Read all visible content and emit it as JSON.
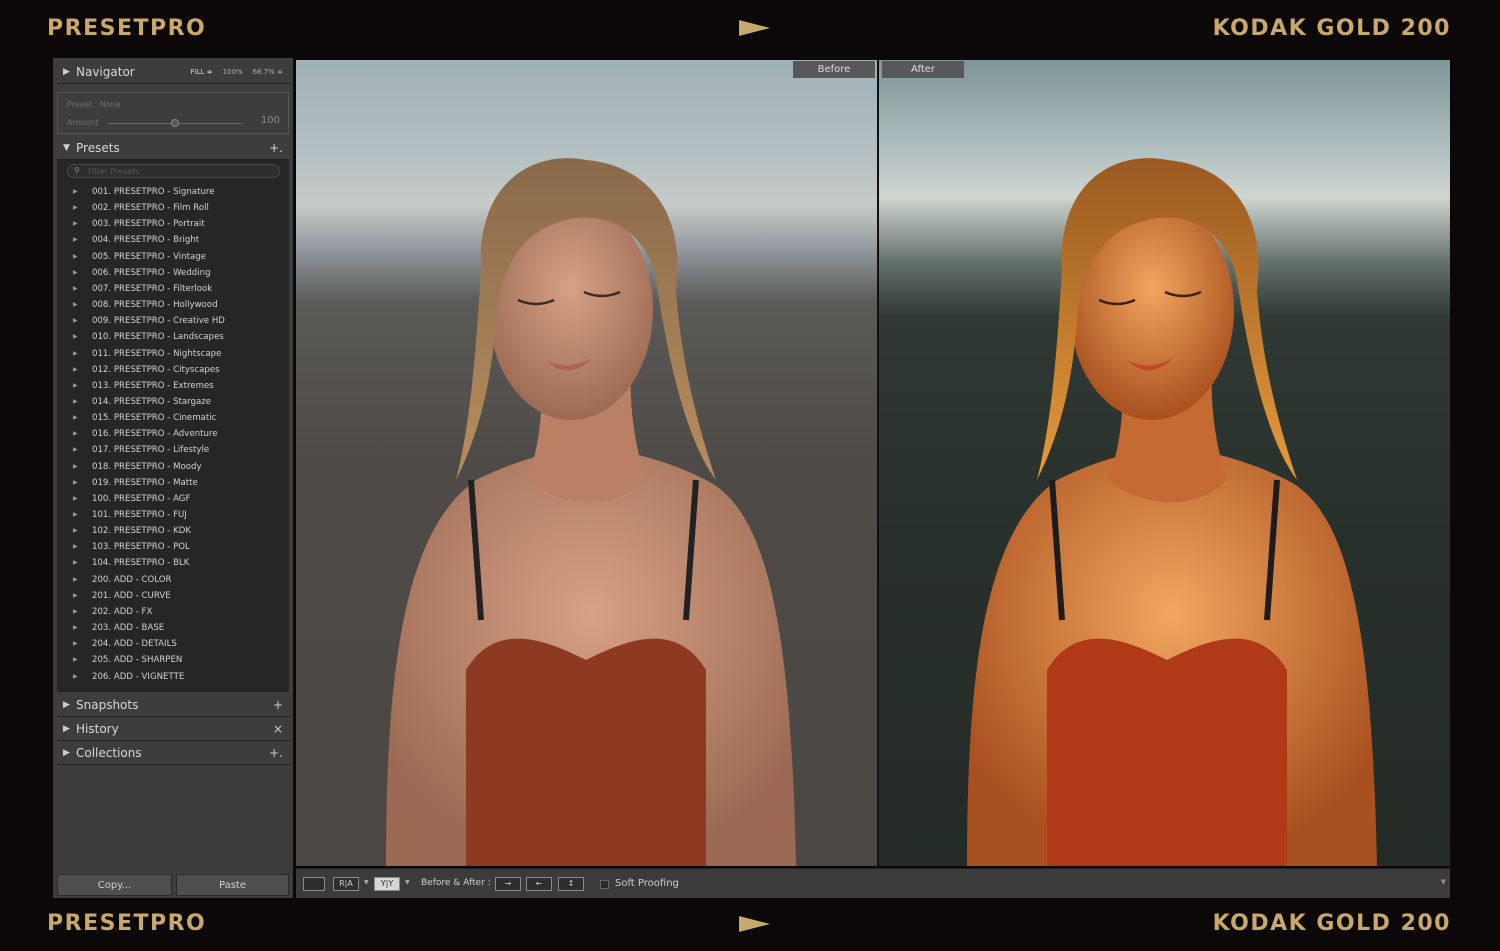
{
  "brand": {
    "left": "PRESETPRO",
    "right": "KODAK GOLD 200",
    "accent_color": "#c9a96a"
  },
  "navigator": {
    "title": "Navigator",
    "fill": "FILL ≑",
    "zoom_100": "100%",
    "zoom_667": "66.7% ≑"
  },
  "preset_info": {
    "preset_label": "Preset : None",
    "amount_label": "Amount",
    "amount_value": "100",
    "amount_fraction": 0.5
  },
  "presets_panel": {
    "title": "Presets",
    "add": "+.",
    "filter_placeholder": "Filter Presets",
    "items": [
      "001. PRESETPRO - Signature",
      "002. PRESETPRO - Film Roll",
      "003. PRESETPRO - Portrait",
      "004. PRESETPRO - Bright",
      "005. PRESETPRO - Vintage",
      "006. PRESETPRO - Wedding",
      "007. PRESETPRO - Filterlook",
      "008. PRESETPRO - Hollywood",
      "009. PRESETPRO - Creative HD",
      "010. PRESETPRO - Landscapes",
      "011. PRESETPRO - Nightscape",
      "012. PRESETPRO - Cityscapes",
      "013. PRESETPRO - Extremes",
      "014. PRESETPRO - Stargaze",
      "015. PRESETPRO - Cinematic",
      "016. PRESETPRO - Adventure",
      "017. PRESETPRO - Lifestyle",
      "018. PRESETPRO - Moody",
      "019. PRESETPRO - Matte",
      "100. PRESETPRO - AGF",
      "101. PRESETPRO - FUJ",
      "102. PRESETPRO - KDK",
      "103. PRESETPRO - POL",
      "104. PRESETPRO - BLK",
      "200. ADD - COLOR",
      "201. ADD - CURVE",
      "202. ADD - FX",
      "203. ADD - BASE",
      "204. ADD - DETAILS",
      "205. ADD - SHARPEN",
      "206. ADD - VIGNETTE"
    ]
  },
  "snapshots": {
    "title": "Snapshots",
    "action": "+"
  },
  "history": {
    "title": "History",
    "action": "×"
  },
  "collections": {
    "title": "Collections",
    "action": "+."
  },
  "buttons": {
    "copy": "Copy...",
    "paste": "Paste"
  },
  "view": {
    "before": "Before",
    "after": "After"
  },
  "toolbar": {
    "loupe": "",
    "ra": "R|A",
    "yy": "Y|Y",
    "before_after_label": "Before & After :",
    "copy_right": "→",
    "copy_left": "←",
    "swap": "↕",
    "soft_proofing": "Soft Proofing"
  }
}
